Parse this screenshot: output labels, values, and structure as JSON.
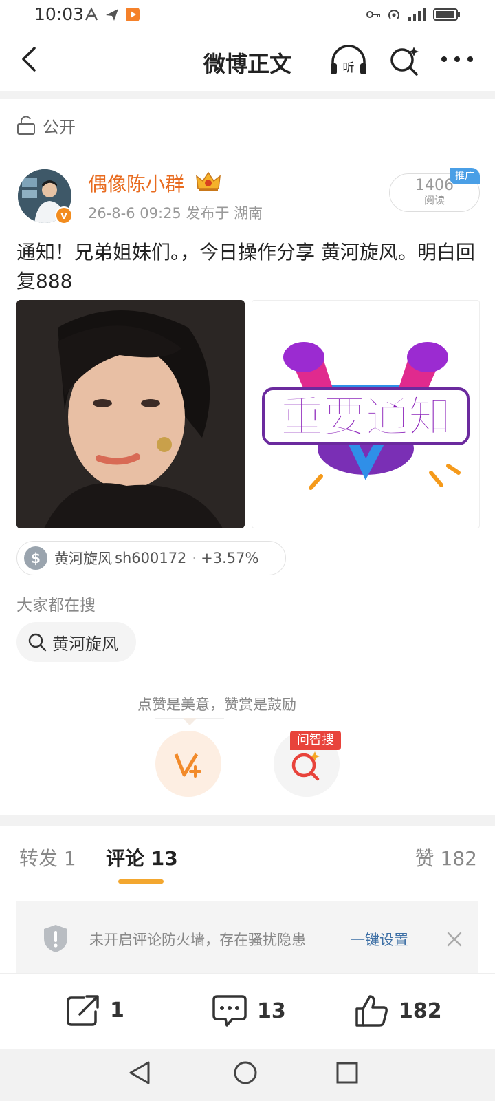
{
  "status_bar": {
    "time": "10:03"
  },
  "nav": {
    "title": "微博正文"
  },
  "visibility": {
    "label": "公开"
  },
  "post": {
    "author": "偶像陈小群",
    "meta": "26-8-6 09:25  发布于 湖南",
    "reads_count": "1406",
    "reads_label": "阅读",
    "promo_tag": "推广",
    "text": "通知！兄弟姐妹们。，今日操作分享 黄河旋风。明白回复888",
    "image_right_text": "重要通知"
  },
  "stock": {
    "name": "黄河旋风",
    "code": "sh600172",
    "sep": "·",
    "change": "+3.57%"
  },
  "trending": {
    "label": "大家都在搜",
    "chip": "黄河旋风"
  },
  "reward": {
    "tip": "点赞是美意，赞赏是鼓励",
    "ask_tag": "问智搜"
  },
  "tabs": {
    "repost_label": "转发",
    "repost_count": "1",
    "comment_label": "评论",
    "comment_count": "13",
    "like_label": "赞",
    "like_count": "182"
  },
  "firewall": {
    "text": "未开启评论防火墙，存在骚扰隐患",
    "link": "一键设置"
  },
  "actions": {
    "repost": "1",
    "comment": "13",
    "like": "182"
  },
  "colors": {
    "accent_orange": "#e86b1f",
    "tab_underline": "#f3a72f",
    "link_blue": "#3d6fa5",
    "promo_blue": "#4a9fe6"
  }
}
